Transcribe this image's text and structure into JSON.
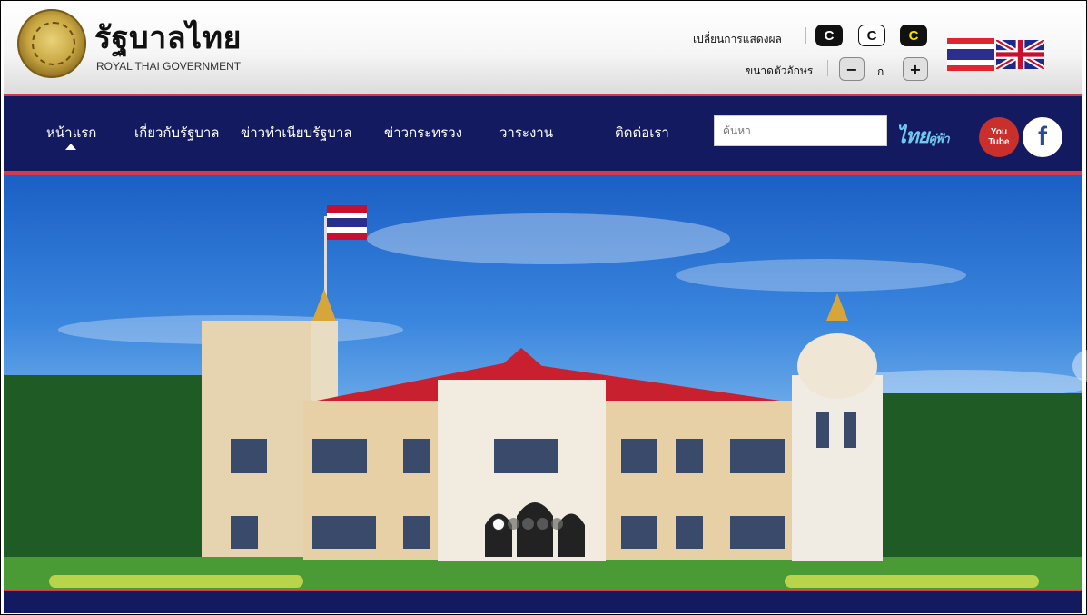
{
  "header": {
    "title": "รัฐบาลไทย",
    "subtitle": "ROYAL THAI GOVERNMENT",
    "display_label": "เปลี่ยนการแสดงผล",
    "display_buttons": [
      "C",
      "C",
      "C"
    ],
    "font_size_label": "ขนาดตัวอักษร",
    "font_minus": "−",
    "font_normal": "ก",
    "font_plus": "+"
  },
  "nav": {
    "items": [
      "หน้าแรก",
      "เกี่ยวกับรัฐบาล",
      "ข่าวทำเนียบรัฐบาล",
      "ข่าวกระทรวง",
      "วาระงาน",
      "ติดต่อเรา"
    ],
    "search_placeholder": "ค้นหา",
    "thai_logo": "ไทย",
    "thai_logo_small": "คู่ฟ้า",
    "youtube_top": "You",
    "youtube_bottom": "Tube",
    "facebook": "f"
  },
  "colors": {
    "nav_bg": "#141a5f",
    "accent_red": "#d63a4a",
    "sky_top": "#1b5fc4"
  },
  "slider": {
    "slide_count": 5,
    "active_index": 0
  }
}
